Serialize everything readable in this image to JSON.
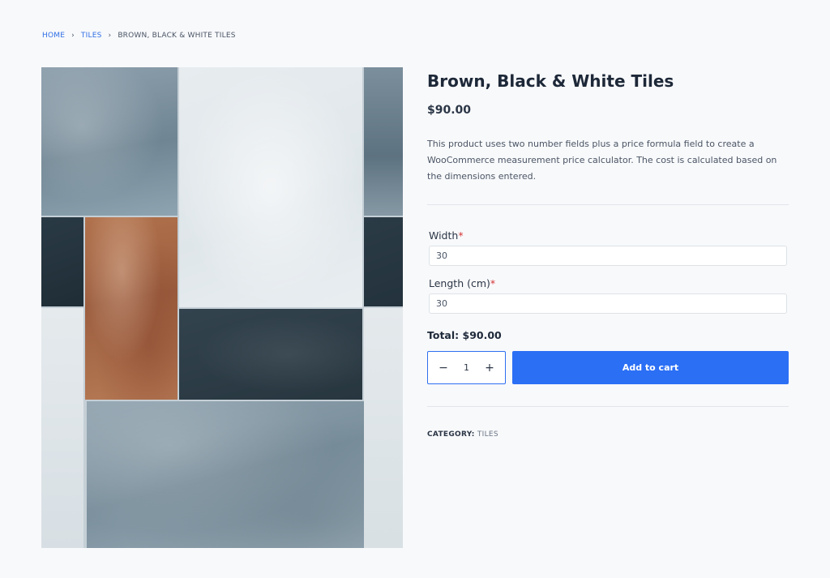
{
  "breadcrumb": {
    "items": [
      {
        "label": "HOME"
      },
      {
        "label": "TILES"
      }
    ],
    "current": "BROWN, BLACK & WHITE TILES"
  },
  "product": {
    "title": "Brown, Black & White Tiles",
    "price": "$90.00",
    "description": "This product uses two number fields plus a price formula field to create a WooCommerce measurement price calculator. The cost is calculated based on the dimensions entered."
  },
  "fields": {
    "width": {
      "label": "Width",
      "required_mark": "*",
      "value": "30"
    },
    "length": {
      "label": "Length (cm)",
      "required_mark": "*",
      "value": "30"
    }
  },
  "total": "Total: $90.00",
  "cart": {
    "minus": "−",
    "plus": "+",
    "quantity": "1",
    "button_label": "Add to cart"
  },
  "meta": {
    "category_label": "CATEGORY:",
    "category_value": "TILES"
  },
  "colors": {
    "accent": "#2b6ff5",
    "link": "#2f6fe6",
    "required": "#d63638",
    "background": "#f8f9fb"
  }
}
